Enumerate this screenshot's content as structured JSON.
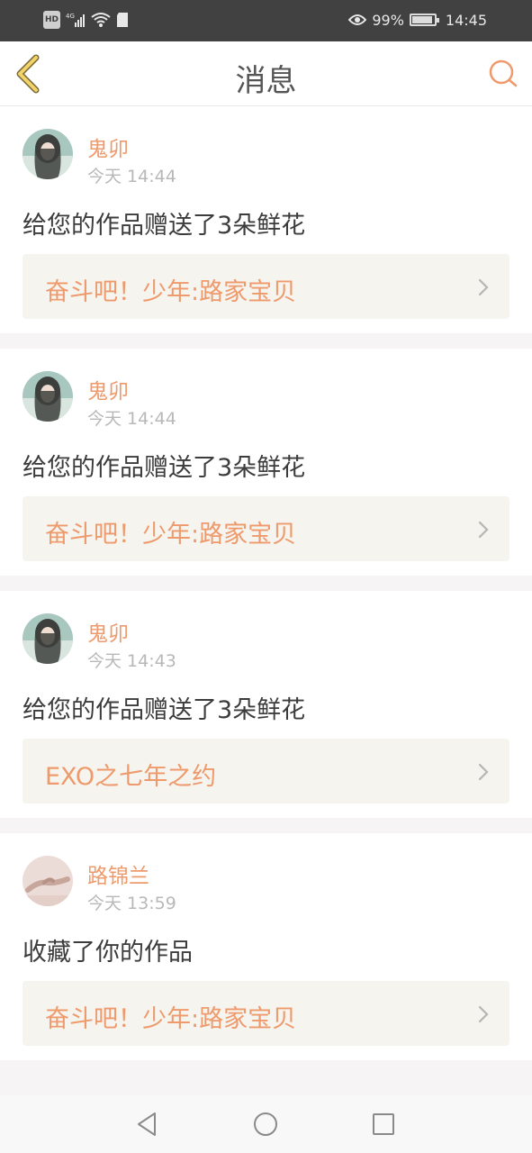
{
  "status_bar": {
    "left_icons": [
      "hd-badge",
      "signal-4g-icon",
      "wifi-icon",
      "sd-card-icon"
    ],
    "hd_label": "HD",
    "battery_percent": "99%",
    "time": "14:45"
  },
  "header": {
    "title": "消息"
  },
  "messages": [
    {
      "name": "鬼卯",
      "time": "今天 14:44",
      "text": "给您的作品赠送了3朵鲜花",
      "work": "奋斗吧！少年:路家宝贝"
    },
    {
      "name": "鬼卯",
      "time": "今天 14:44",
      "text": "给您的作品赠送了3朵鲜花",
      "work": "奋斗吧！少年:路家宝贝"
    },
    {
      "name": "鬼卯",
      "time": "今天 14:43",
      "text": "给您的作品赠送了3朵鲜花",
      "work": "EXO之七年之约"
    },
    {
      "name": "路锦兰",
      "time": "今天 13:59",
      "text": "收藏了你的作品",
      "work": "奋斗吧！少年:路家宝贝"
    }
  ],
  "colors": {
    "accent": "#ee9a6c",
    "back_arrow": "#e8c45a",
    "status_bar_bg": "#414141"
  }
}
